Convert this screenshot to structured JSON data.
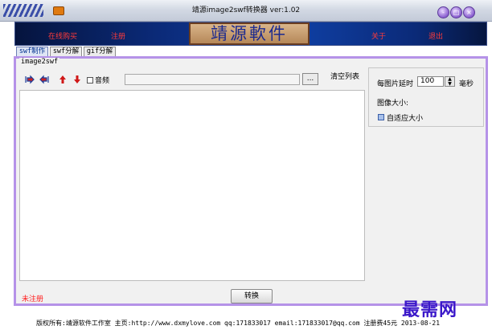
{
  "window": {
    "title": "靖源image2swf转换器 ver:1.02",
    "buttons": [
      "-",
      "□",
      "×"
    ]
  },
  "banner": {
    "links": {
      "buy": "在线购买",
      "register": "注册",
      "about": "关于",
      "exit": "退出"
    },
    "logo_text": "靖源軟件"
  },
  "tabs": [
    {
      "label": "swf制作",
      "active": true
    },
    {
      "label": "swf分解",
      "active": false
    },
    {
      "label": "gif分解",
      "active": false
    }
  ],
  "group_title": "image2swf",
  "toolbar": {
    "audio_label": "音频",
    "audio_path_value": "",
    "browse_label": "...",
    "clear_label": "清空列表"
  },
  "settings": {
    "delay_label": "每图片延时",
    "delay_value": "100",
    "delay_unit": "毫秒",
    "size_label": "图像大小:",
    "fit_label": "自适应大小"
  },
  "status": {
    "registration": "未注册"
  },
  "convert_label": "转换",
  "footer": "版权所有:靖源软件工作室 主页:http://www.dxmylove.com qq:171833017 email:171833017@qq.com 注册费45元 2013-08-21",
  "watermark": "最需网",
  "colors": {
    "accent_purple": "#b592e8",
    "banner_blue": "#0b2a78",
    "red_text": "#ff2020"
  }
}
